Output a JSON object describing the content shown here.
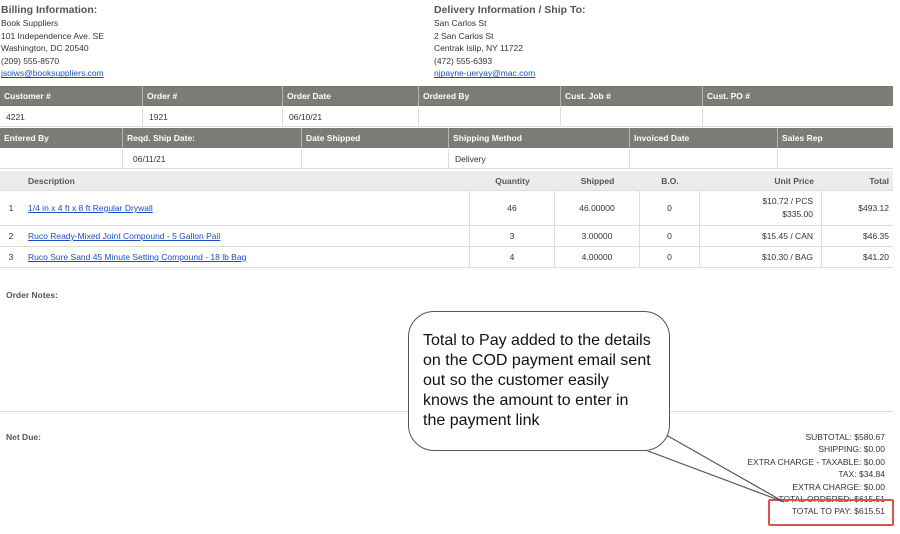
{
  "billing": {
    "title": "Billing Information:",
    "name": "Book Suppliers",
    "address1": "101 Independence Ave. SE",
    "city": "Washington, DC 20540",
    "phone": "(209) 555-8570",
    "email": "jsoiws@booksuppliers.com"
  },
  "delivery": {
    "title": "Delivery Information / Ship To:",
    "name": "San Carlos St",
    "address1": "2 San Carlos St",
    "city": "Centrak Islip, NY 11722",
    "phone": "(472) 555-6393",
    "email": "njpayne-ueryay@mac.com"
  },
  "order_header": {
    "labels": [
      "Customer #",
      "Order #",
      "Order Date",
      "Ordered By",
      "Cust. Job #",
      "Cust. PO #"
    ],
    "values": [
      "4221",
      "1921",
      "06/10/21",
      "",
      "",
      ""
    ]
  },
  "ship_header": {
    "labels": [
      "Entered By",
      "Reqd. Ship Date:",
      "Date Shipped",
      "Shipping Method",
      "Invoiced Date",
      "Sales Rep"
    ],
    "values": [
      "",
      "06/11/21",
      "",
      "Delivery",
      "",
      ""
    ]
  },
  "items": {
    "headers": {
      "description": "Description",
      "quantity": "Quantity",
      "shipped": "Shipped",
      "bo": "B.O.",
      "unit_price": "Unit Price",
      "total": "Total"
    },
    "rows": [
      {
        "num": "1",
        "description": "1/4 in x 4 ft x 8 ft Regular Drywall",
        "quantity": "46",
        "shipped": "46.00000",
        "bo": "0",
        "unit_price": "$10.72 / PCS",
        "unit_price_2": "$335.00",
        "total": "$493.12"
      },
      {
        "num": "2",
        "description": "Ruco Ready-Mixed Joint Compound - 5 Gallon Pail",
        "quantity": "3",
        "shipped": "3.00000",
        "bo": "0",
        "unit_price": "$15.45 / CAN",
        "unit_price_2": "",
        "total": "$46.35"
      },
      {
        "num": "3",
        "description": "Ruco Sure Sand 45 Minute Setting Compound - 18 lb Bag",
        "quantity": "4",
        "shipped": "4.00000",
        "bo": "0",
        "unit_price": "$10.30 / BAG",
        "unit_price_2": "",
        "total": "$41.20"
      }
    ]
  },
  "order_notes_label": "Order Notes:",
  "net_due_label": "Net Due:",
  "totals": {
    "subtotal": "SUBTOTAL: $580.67",
    "shipping": "SHIPPING: $0.00",
    "extra_taxable": "EXTRA CHARGE - TAXABLE: $0.00",
    "tax": "TAX: $34.84",
    "extra": "EXTRA CHARGE: $0.00",
    "total_ordered": "TOTAL ORDERED: $615.51",
    "total_to_pay": "TOTAL TO PAY: $615.51"
  },
  "callout_text": "Total to Pay added to the details on the COD payment email sent out so the customer easily knows the amount to enter in the payment link",
  "colors": {
    "header_bg": "#7d7b77",
    "link": "#1a4fc4",
    "highlight": "#d9534f"
  }
}
